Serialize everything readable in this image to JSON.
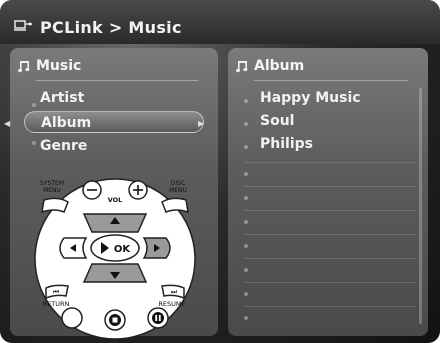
{
  "header": {
    "breadcrumb": "PCLink > Music"
  },
  "left_panel": {
    "title": "Music",
    "items": [
      {
        "label": "Artist"
      },
      {
        "label": "Album",
        "selected": true
      },
      {
        "label": "Genre"
      }
    ]
  },
  "right_panel": {
    "title": "Album",
    "items": [
      {
        "label": "Happy Music"
      },
      {
        "label": "Soul"
      },
      {
        "label": "Philips"
      }
    ]
  },
  "remote": {
    "system_menu": "SYSTEM\nMENU",
    "vol": "VOL",
    "disc_menu": "DISC\nMENU",
    "ok": "OK",
    "return": "RETURN",
    "resume": "RESUME"
  },
  "colors": {
    "background": "#1a1a1a",
    "panel": "#6a6a6a",
    "text": "#f2f2f2"
  }
}
